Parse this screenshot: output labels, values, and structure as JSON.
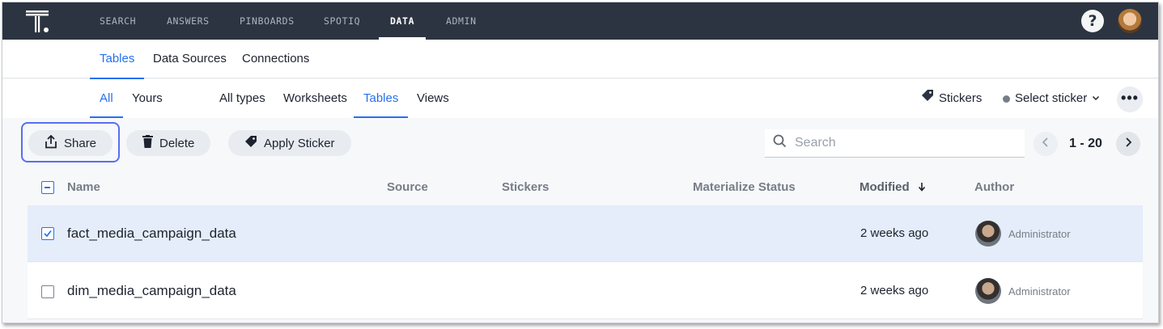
{
  "topnav": {
    "items": [
      "SEARCH",
      "ANSWERS",
      "PINBOARDS",
      "SPOTIQ",
      "DATA",
      "ADMIN"
    ],
    "active": "DATA",
    "help_label": "?"
  },
  "subnav": {
    "items": [
      "Tables",
      "Data Sources",
      "Connections"
    ],
    "active": "Tables"
  },
  "filters": {
    "ownership": [
      "All",
      "Yours"
    ],
    "types": [
      "All types",
      "Worksheets",
      "Tables",
      "Views"
    ],
    "stickers_label": "Stickers",
    "select_sticker_label": "Select sticker",
    "more_label": "•••"
  },
  "actions": {
    "share_label": "Share",
    "delete_label": "Delete",
    "apply_sticker_label": "Apply Sticker",
    "search_placeholder": "Search",
    "pagination": "1 - 20"
  },
  "table": {
    "columns": [
      "Name",
      "Source",
      "Stickers",
      "Materialize Status",
      "Modified",
      "Author"
    ],
    "rows": [
      {
        "name": "fact_media_campaign_data",
        "modified": "2 weeks ago",
        "author": "Administrator",
        "selected": true
      },
      {
        "name": "dim_media_campaign_data",
        "modified": "2 weeks ago",
        "author": "Administrator",
        "selected": false
      }
    ]
  },
  "colors": {
    "nav_bg": "#2c3441",
    "accent": "#2770ef",
    "selected_row": "#e5edfa",
    "focus_ring": "#5a6ef0"
  }
}
